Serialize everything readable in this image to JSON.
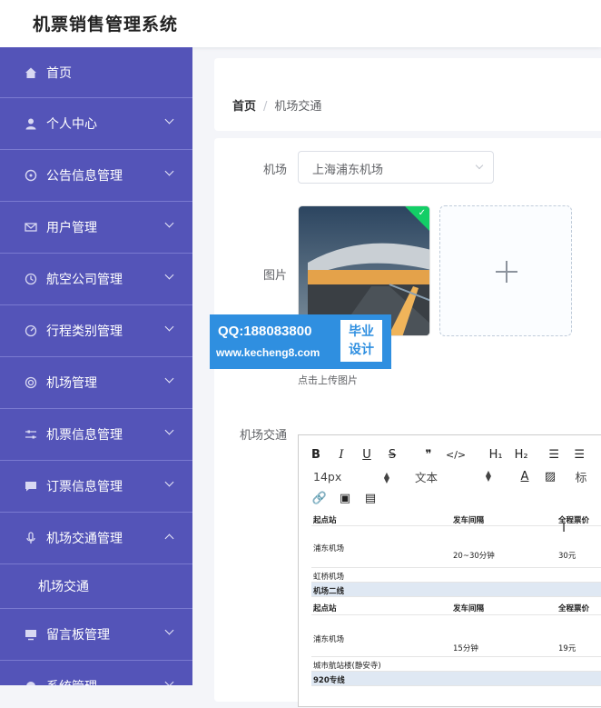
{
  "app": {
    "title": "机票销售管理系统"
  },
  "sidebar": {
    "items": [
      {
        "label": "首页",
        "icon": "home-icon"
      },
      {
        "label": "个人中心",
        "icon": "user-icon"
      },
      {
        "label": "公告信息管理",
        "icon": "compass-icon"
      },
      {
        "label": "用户管理",
        "icon": "mail-icon"
      },
      {
        "label": "航空公司管理",
        "icon": "clock-icon"
      },
      {
        "label": "行程类别管理",
        "icon": "gauge-icon"
      },
      {
        "label": "机场管理",
        "icon": "target-icon"
      },
      {
        "label": "机票信息管理",
        "icon": "sliders-icon"
      },
      {
        "label": "订票信息管理",
        "icon": "chat-icon"
      },
      {
        "label": "机场交通管理",
        "icon": "mic-icon"
      },
      {
        "label": "留言板管理",
        "icon": "monitor-icon"
      },
      {
        "label": "系统管理",
        "icon": "settings-icon"
      }
    ],
    "submenu": {
      "label": "机场交通"
    }
  },
  "breadcrumb": {
    "home": "首页",
    "separator": "/",
    "current": "机场交通"
  },
  "form": {
    "airport_label": "机场",
    "airport_value": "上海浦东机场",
    "image_label": "图片",
    "upload_hint": "点击上传图片",
    "traffic_label": "机场交通"
  },
  "watermark": {
    "line1": "QQ:188083800",
    "line2": "www.kecheng8.com",
    "badge1": "毕业",
    "badge2": "设计"
  },
  "editor": {
    "toolbar": {
      "bold": "B",
      "italic": "I",
      "underline": "U",
      "strike": "S",
      "quote": "❞",
      "code": "</>",
      "h1": "H₁",
      "h2": "H₂",
      "font_size": "14px",
      "font_type": "文本",
      "font_color": "A",
      "heading": "标"
    },
    "table": [
      {
        "shade": false,
        "c1": "起点站",
        "c2": "发车间隔",
        "c3": "全程票价"
      },
      {
        "shade": false,
        "c1": "浦东机场",
        "c2": "20~30分钟",
        "c3": "30元"
      },
      {
        "shade": false,
        "c1": "虹桥机场",
        "c2": "",
        "c3": ""
      },
      {
        "shade": true,
        "c1": "机场二线",
        "c2": "",
        "c3": ""
      },
      {
        "shade": false,
        "c1": "起点站",
        "c2": "发车间隔",
        "c3": "全程票价"
      },
      {
        "shade": false,
        "c1": "浦东机场",
        "c2": "15分钟",
        "c3": "19元"
      },
      {
        "shade": false,
        "c1": "城市航站楼(静安寺)",
        "c2": "",
        "c3": ""
      },
      {
        "shade": true,
        "c1": "920专线",
        "c2": "",
        "c3": ""
      }
    ]
  }
}
